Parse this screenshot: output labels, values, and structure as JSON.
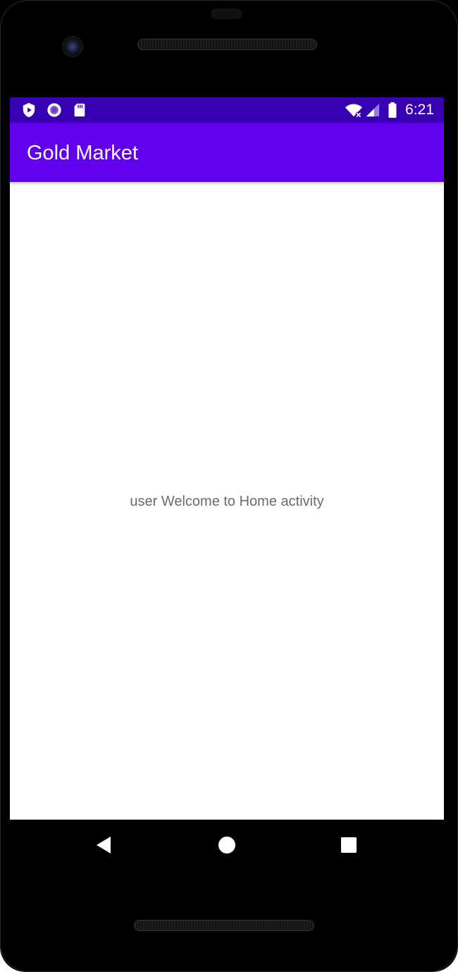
{
  "theme": {
    "status_bar_color": "#3700B3",
    "app_bar_color": "#6200EE",
    "text_color": "#6b6b6b"
  },
  "status_bar": {
    "left_icons": [
      "play-protect-icon",
      "record-circle-icon",
      "sd-card-icon"
    ],
    "right_icons": [
      "wifi-icon",
      "cell-signal-icon",
      "battery-icon"
    ],
    "time": "6:21"
  },
  "app_bar": {
    "title": "Gold Market"
  },
  "content": {
    "message": "user Welcome to Home activity"
  },
  "navigation": {
    "buttons": [
      "back-icon",
      "home-icon",
      "recents-icon"
    ]
  }
}
